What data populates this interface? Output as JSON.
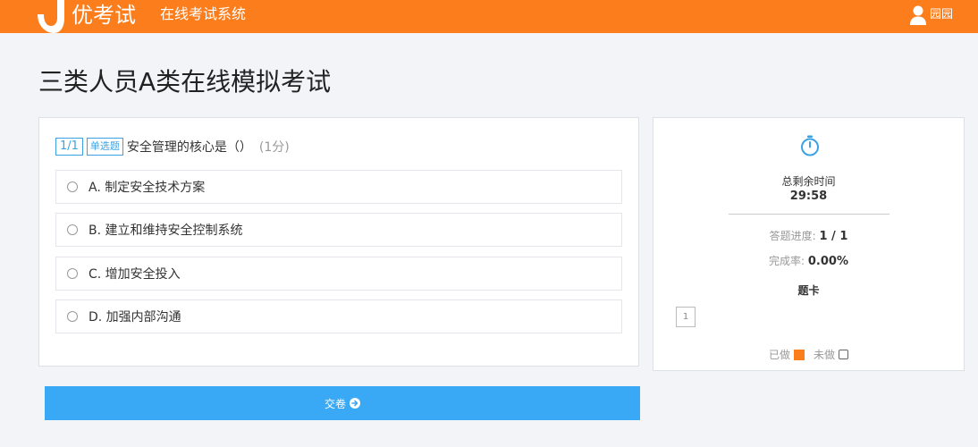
{
  "header": {
    "logo_text": "优考试",
    "system_name": "在线考试系统",
    "user_name": "园园",
    "brand_color": "#fb7d1c"
  },
  "page": {
    "title": "三类人员A类在线模拟考试"
  },
  "question": {
    "number": "1/1",
    "type": "单选题",
    "text": "安全管理的核心是（）",
    "score": "(1分)",
    "options": [
      {
        "label": "A. 制定安全技术方案"
      },
      {
        "label": "B. 建立和维持安全控制系统"
      },
      {
        "label": "C. 增加安全投入"
      },
      {
        "label": "D. 加强内部沟通"
      }
    ]
  },
  "submit": {
    "label": "交卷",
    "color": "#3aa9f5"
  },
  "sidebar": {
    "time_label": "总剩余时间",
    "time_value": "29:58",
    "progress_label": "答题进度:",
    "progress_value": "1 / 1",
    "rate_label": "完成率:",
    "rate_value": "0.00%",
    "card_title": "题卡",
    "cells": [
      "1"
    ],
    "legend_done": "已做",
    "legend_todo": "未做",
    "accent_color": "#3ba3e5"
  }
}
